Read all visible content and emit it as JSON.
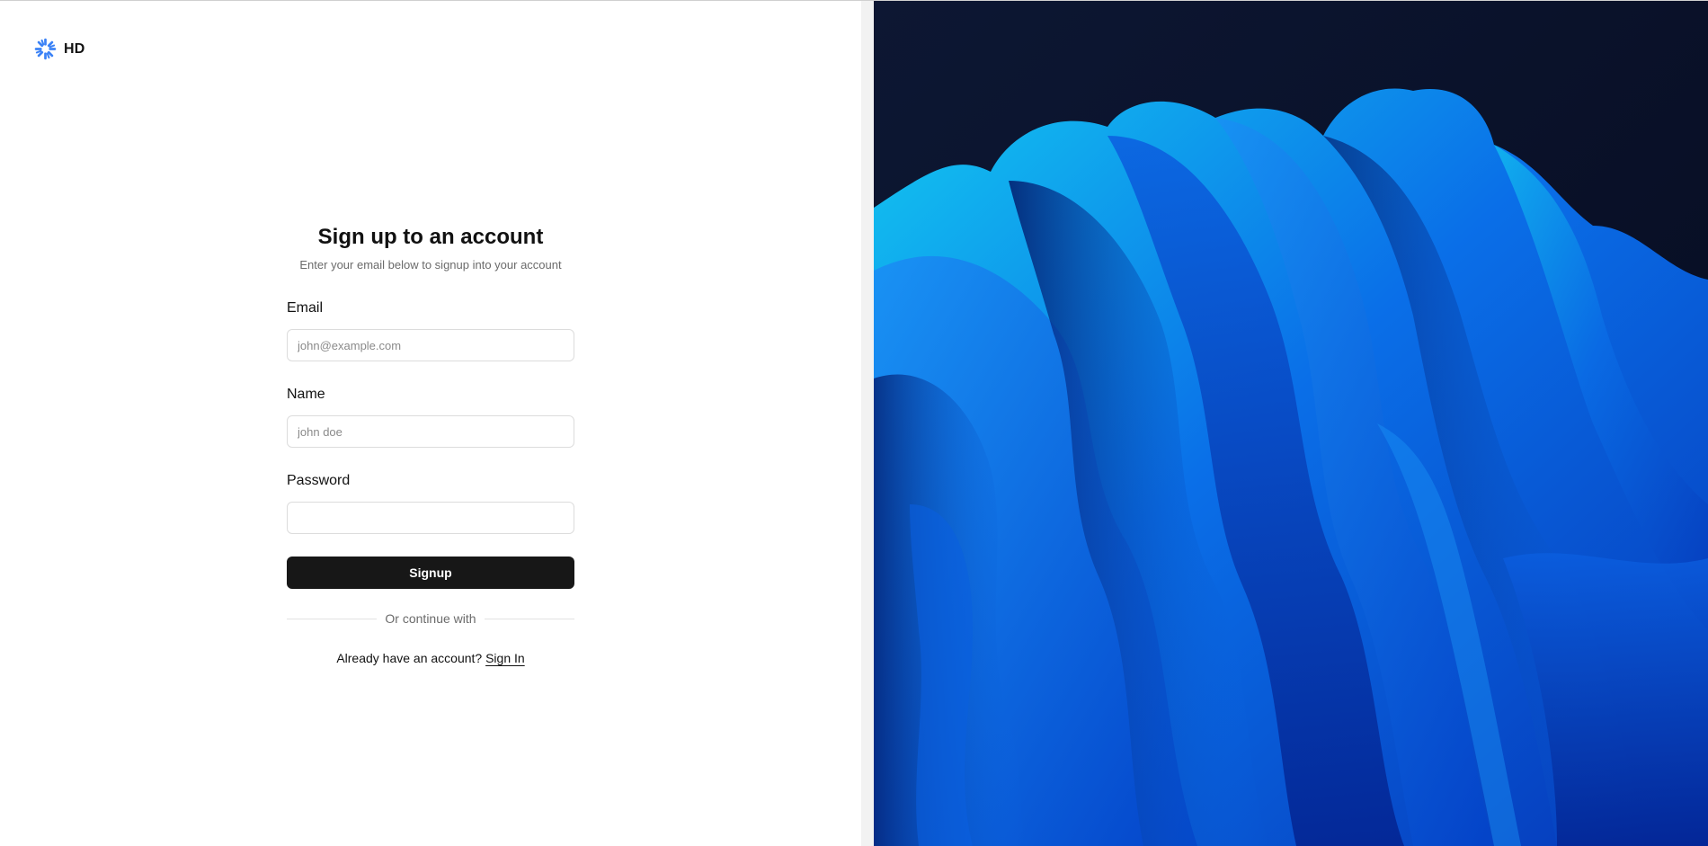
{
  "brand": {
    "logo_text": "HD",
    "logo_icon": "spinner-burst-icon",
    "logo_color": "#3b82f6"
  },
  "form": {
    "title": "Sign up to an account",
    "subtitle": "Enter your email below to signup into your account",
    "email": {
      "label": "Email",
      "placeholder": "john@example.com",
      "value": ""
    },
    "name": {
      "label": "Name",
      "placeholder": "john doe",
      "value": ""
    },
    "password": {
      "label": "Password",
      "placeholder": "",
      "value": ""
    },
    "submit_label": "Signup",
    "divider_text": "Or continue with",
    "signin_prompt": "Already have an account?",
    "signin_link": "Sign In"
  },
  "colors": {
    "primary_button": "#171717",
    "hero_background": "#0b1430",
    "hero_accent": "#0a6cf0"
  }
}
